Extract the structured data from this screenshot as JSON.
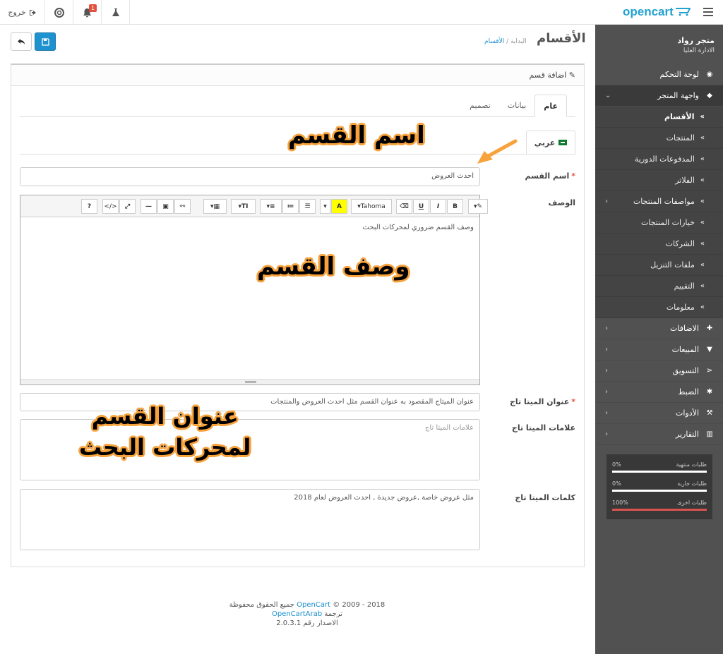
{
  "header": {
    "logout_label": "خروج",
    "notification_count": "1",
    "logo_text": "opencart"
  },
  "sidebar": {
    "store_name": "متجر رواد",
    "role": "الادارة العليا",
    "items": [
      {
        "label": "لوحة التحكم",
        "icon": "dashboard-icon"
      },
      {
        "label": "واجهة المتجر",
        "icon": "tag-icon",
        "expanded": true
      },
      {
        "label": "الاضافات",
        "icon": "puzzle-icon"
      },
      {
        "label": "المبيعات",
        "icon": "cart-icon"
      },
      {
        "label": "التسويق",
        "icon": "share-icon"
      },
      {
        "label": "الضبط",
        "icon": "gear-icon"
      },
      {
        "label": "الأدوات",
        "icon": "wrench-icon"
      },
      {
        "label": "التقارير",
        "icon": "bar-chart-icon"
      }
    ],
    "sub_items": [
      {
        "label": "الأقسام"
      },
      {
        "label": "المنتجات"
      },
      {
        "label": "المدفوعات الدورية"
      },
      {
        "label": "الفلاتر"
      },
      {
        "label": "مواصفات المنتجات"
      },
      {
        "label": "خيارات المنتجات"
      },
      {
        "label": "الشركات"
      },
      {
        "label": "ملفات التنزيل"
      },
      {
        "label": "التقييم"
      },
      {
        "label": "معلومات"
      }
    ],
    "stats": [
      {
        "label": "طلبات منتهية",
        "percent": "0%",
        "value": 0
      },
      {
        "label": "طلبات جارية",
        "percent": "0%",
        "value": 0
      },
      {
        "label": "طلبات اخرى",
        "percent": "100%",
        "value": 100
      }
    ]
  },
  "page": {
    "title": "الأقسام",
    "breadcrumb_home": "البداية",
    "breadcrumb_sep": "/",
    "breadcrumb_current": "الأقسام",
    "panel_title": "اضافة قسم",
    "tabs": [
      "عام",
      "بيانات",
      "تصميم"
    ],
    "language_tab": "عربي"
  },
  "form": {
    "name_label": "اسم القسم",
    "name_value": "احدث العروض",
    "description_label": "الوصف",
    "description_value": "وصف القسم ضروري لمحركات البحث",
    "meta_title_label": "عنوان الميتا تاج",
    "meta_title_value": "عنوان الميتاج المقصود به عنوان القسم مثل احدث العروض والمنتجات",
    "meta_desc_label": "علامات الميتا تاج",
    "meta_desc_placeholder": "علامات الميتا تاج",
    "meta_keywords_label": "كلمات الميتا تاج",
    "meta_keywords_value": "مثل عروض خاصة ,عروض جديدة , احدث العروض لعام 2018"
  },
  "editor": {
    "font_label": "Tahoma",
    "buttons": [
      "?",
      "</>",
      "⤢",
      "—",
      "▣",
      "🔗",
      "▦",
      "T↕",
      "≡",
      "1.",
      "•",
      "A",
      "Tahoma",
      "⌫",
      "U",
      "I",
      "B",
      "✎"
    ]
  },
  "annotations": {
    "name_note": "اسم القسم",
    "desc_note": "وصف القسم",
    "meta_note_line1": "عنوان القسم",
    "meta_note_line2": "لمحركات البحث"
  },
  "footer": {
    "line1_prefix": "2018 - 2009 ©",
    "line1_link": "OpenCart",
    "line1_suffix": "جميع الحقوق محفوظة",
    "line2_prefix": "ترجمة",
    "line2_link": "OpenCartArab",
    "line3": "الاصدار رقم 2.0.3.1"
  },
  "colors": {
    "accent": "#1e91cf",
    "sidebar_bg": "#515151",
    "annotation_outline": "#f7a23b",
    "required": "#e3503e"
  }
}
